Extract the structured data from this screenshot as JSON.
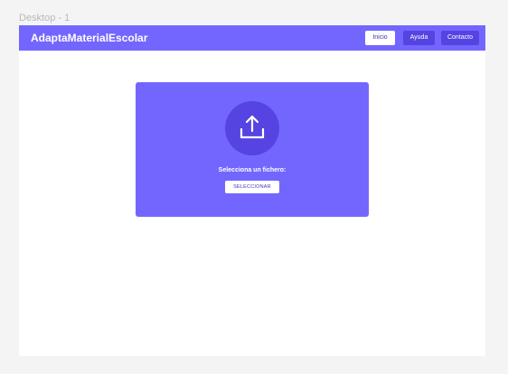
{
  "canvas": {
    "frame_label": "Desktop - 1"
  },
  "navbar": {
    "brand": "AdaptaMaterialEscolar",
    "items": [
      {
        "label": "Inicio",
        "active": true
      },
      {
        "label": "Ayuda",
        "active": false
      },
      {
        "label": "Contacto",
        "active": false
      }
    ]
  },
  "upload": {
    "icon": "upload-icon",
    "prompt": "Selecciona un fichero:",
    "button_label": "SELECCIONAR"
  },
  "colors": {
    "accent": "#7366ff",
    "accent_dark": "#5543e2",
    "frame_bg": "#ffffff",
    "canvas_bg": "#f4f4f4"
  }
}
